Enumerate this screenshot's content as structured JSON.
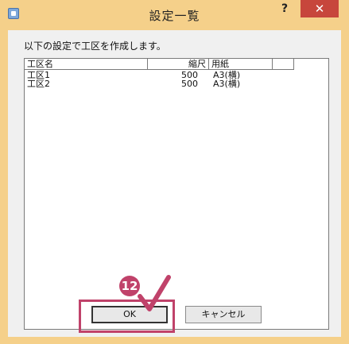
{
  "window": {
    "title": "設定一覧"
  },
  "titlebar": {
    "help_glyph": "?",
    "close_glyph": "✕"
  },
  "dialog": {
    "message": "以下の設定で工区を作成します。",
    "columns": [
      "工区名",
      "縮尺",
      "用紙"
    ],
    "rows": [
      {
        "name": "工区1",
        "scale": "500",
        "paper": "A3(横)"
      },
      {
        "name": "工区2",
        "scale": "500",
        "paper": "A3(横)"
      }
    ]
  },
  "buttons": {
    "ok": "OK",
    "cancel": "キャンセル"
  },
  "annotation": {
    "step_number": "12"
  },
  "colors": {
    "titlebar": "#f5d08a",
    "close": "#c7463c",
    "annotation": "#c0426a"
  }
}
